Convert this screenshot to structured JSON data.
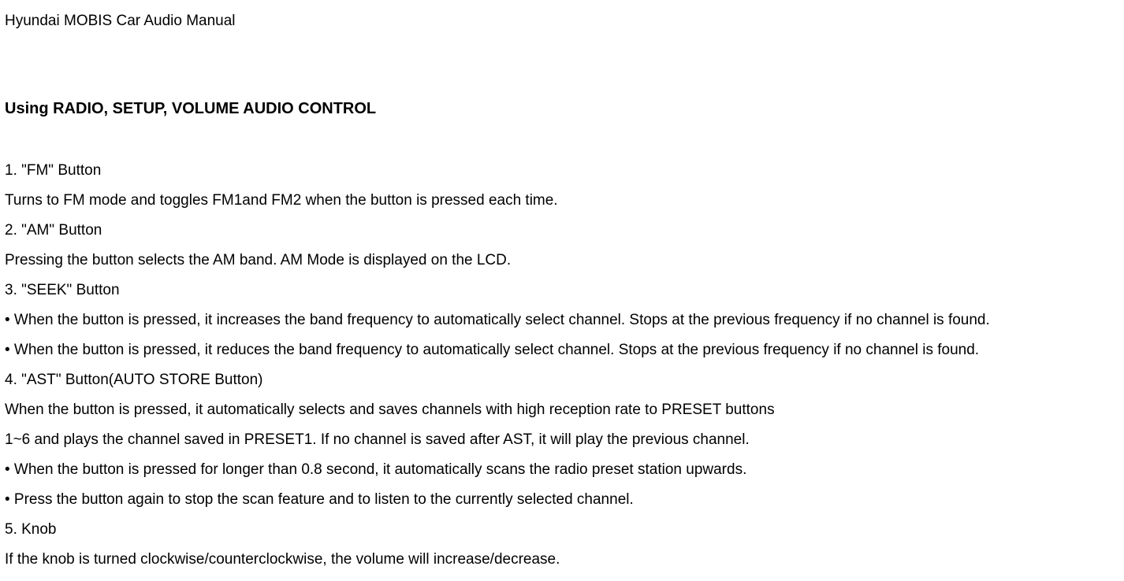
{
  "docTitle": "Hyundai MOBIS Car Audio Manual",
  "sectionHeading": "Using RADIO, SETUP, VOLUME AUDIO CONTROL",
  "lines": [
    "1. \"FM\" Button",
    "Turns to FM mode and toggles FM1and FM2 when the button is pressed each time.",
    "2. \"AM\" Button",
    "Pressing the button selects the AM band. AM Mode is displayed on the LCD.",
    "3. \"SEEK\" Button",
    "• When the button is pressed, it increases the band frequency to automatically select channel. Stops at the previous frequency if no channel is found.",
    "• When the button is pressed, it reduces the band frequency to automatically select channel. Stops at the previous frequency if no channel is found.",
    "4. \"AST\" Button(AUTO STORE Button)",
    "When the button is pressed, it automatically selects and saves channels with high reception rate to PRESET buttons",
    "1~6 and plays the channel saved in PRESET1. If no channel is saved after AST, it will play the previous channel.",
    "• When the button is pressed for longer than 0.8 second, it automatically scans the radio preset station upwards.",
    "• Press the button again to stop the scan feature and to listen to the currently selected channel.",
    "5. Knob",
    "If the knob is turned clockwise/counterclockwise, the volume will increase/decrease."
  ]
}
